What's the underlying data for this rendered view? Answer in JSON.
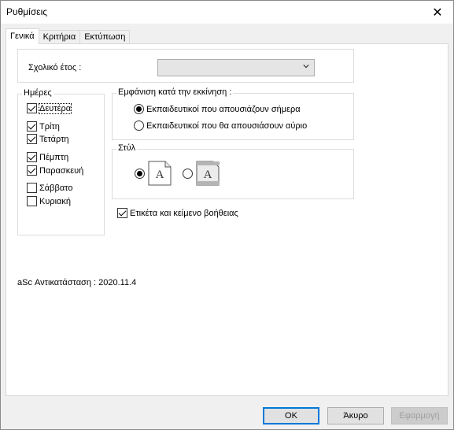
{
  "window": {
    "title": "Ρυθμίσεις",
    "close_symbol": "✕"
  },
  "tabs": [
    {
      "label": "Γενικά",
      "active": true
    },
    {
      "label": "Κριτήρια",
      "active": false
    },
    {
      "label": "Εκτύπωση",
      "active": false
    }
  ],
  "school_year": {
    "label": "Σχολικό έτος :",
    "value": ""
  },
  "days": {
    "legend": "Ημέρες",
    "items": [
      {
        "label": "Δευτέρα",
        "checked": true,
        "focused": true
      },
      {
        "label": "Τρίτη",
        "checked": true
      },
      {
        "label": "Τετάρτη",
        "checked": true
      },
      {
        "label": "Πέμπτη",
        "checked": true
      },
      {
        "label": "Παρασκευή",
        "checked": true
      },
      {
        "label": "Σάββατο",
        "checked": false
      },
      {
        "label": "Κυριακή",
        "checked": false
      }
    ]
  },
  "startup_display": {
    "legend": "Εμφάνιση κατά την εκκίνηση :",
    "options": [
      {
        "label": "Εκπαιδευτικοί που απουσιάζουν σήμερα",
        "selected": true
      },
      {
        "label": "Εκπαιδευτικοί που θα απουσιάσουν αύριο",
        "selected": false
      }
    ]
  },
  "style": {
    "legend": "Στύλ",
    "options": [
      {
        "icon": "document-a-icon",
        "selected": true
      },
      {
        "icon": "document-a-shaded-icon",
        "selected": false
      }
    ],
    "glyph": "A"
  },
  "help_labels": {
    "label": "Ετικέτα και κείμενο βοήθειας",
    "checked": true
  },
  "version_text": "aSc Αντικατάσταση : 2020.11.4",
  "buttons": {
    "ok": "OK",
    "cancel": "Άκυρο",
    "apply": "Εφαρμογή"
  },
  "colors": {
    "default_button_border": "#0078d7",
    "window_bg": "#f0f0f0"
  }
}
